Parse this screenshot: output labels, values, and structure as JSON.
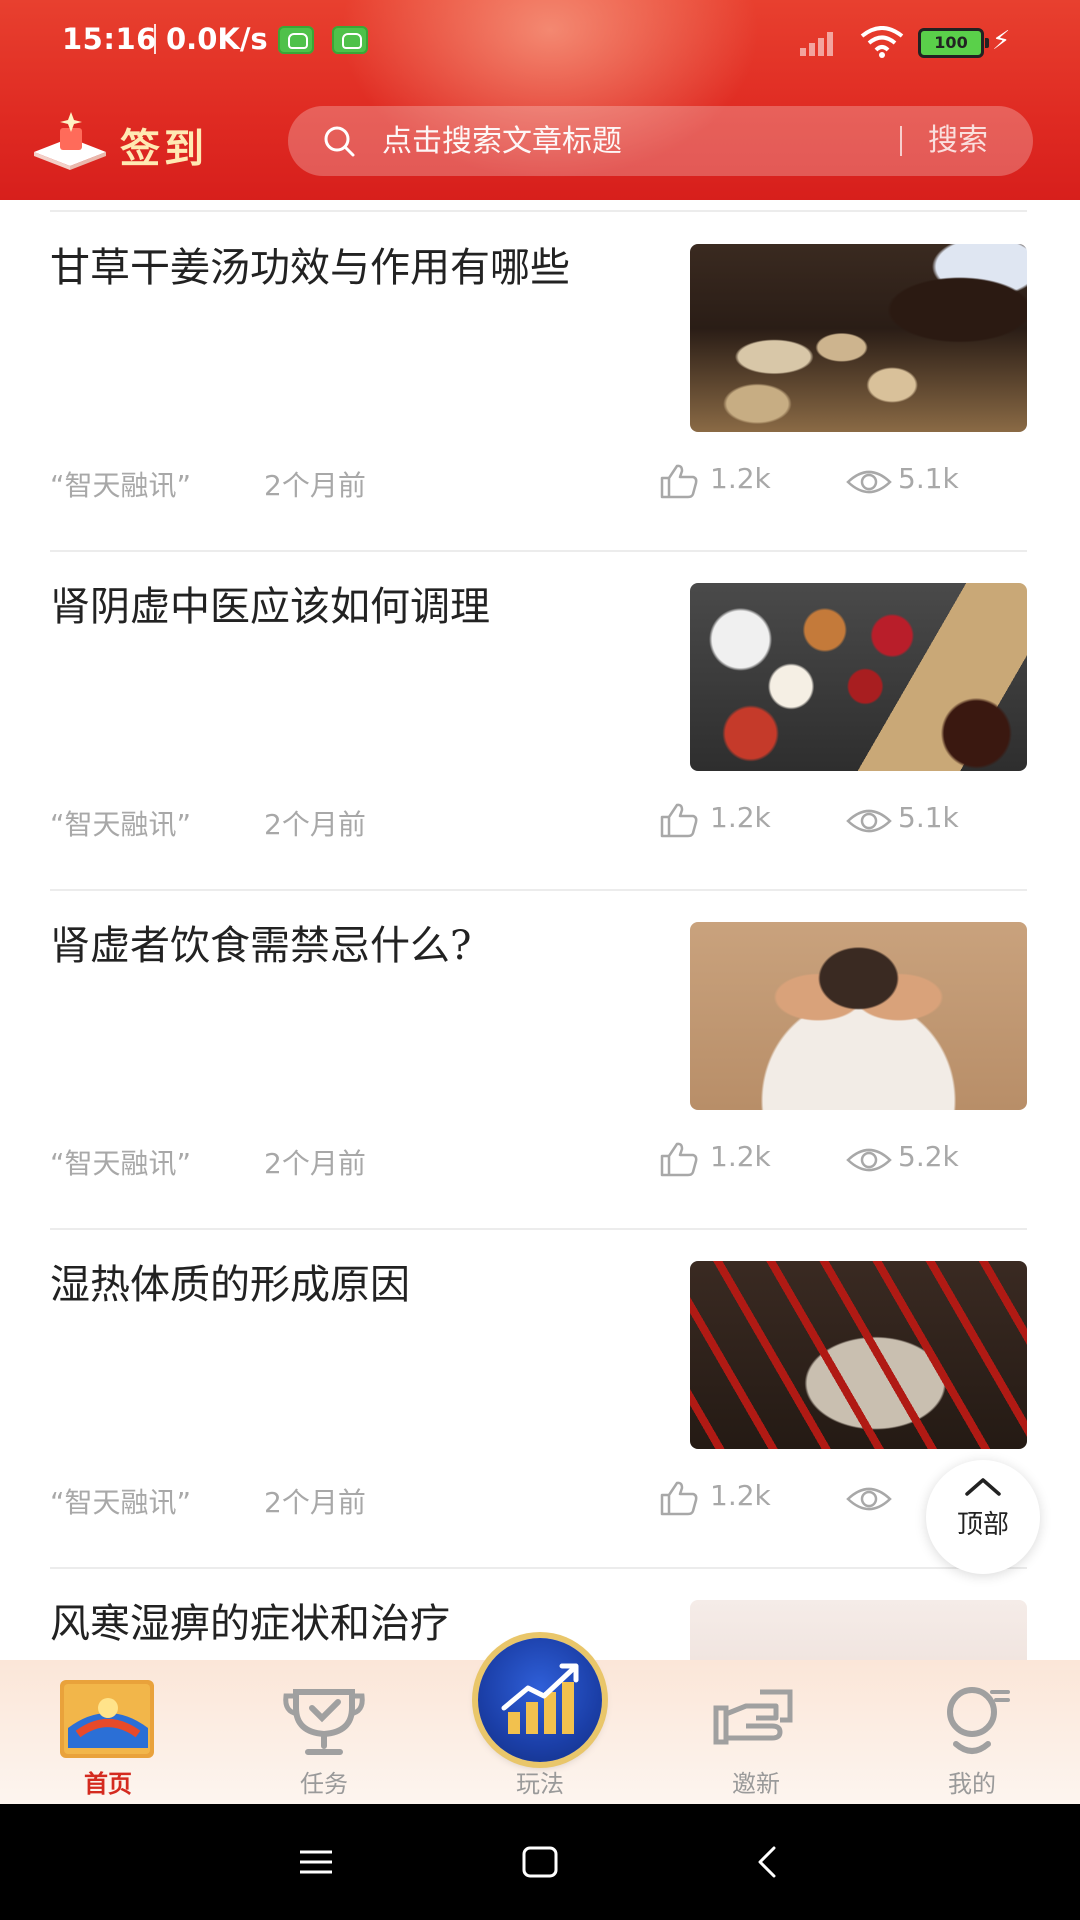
{
  "status_bar": {
    "time": "15:16",
    "net_speed": "0.0K/s",
    "battery": "100"
  },
  "header": {
    "signin_label": "签到",
    "search_placeholder": "点击搜索文章标题",
    "search_button": "搜索"
  },
  "articles": [
    {
      "title": "甘草干姜汤功效与作用有哪些",
      "source": "“智天融讯”",
      "time": "2个月前",
      "likes": "1.2k",
      "views": "5.1k"
    },
    {
      "title": "肾阴虚中医应该如何调理",
      "source": "“智天融讯”",
      "time": "2个月前",
      "likes": "1.2k",
      "views": "5.1k"
    },
    {
      "title": "肾虚者饮食需禁忌什么?",
      "source": "“智天融讯”",
      "time": "2个月前",
      "likes": "1.2k",
      "views": "5.2k"
    },
    {
      "title": "湿热体质的形成原因",
      "source": "“智天融讯”",
      "time": "2个月前",
      "likes": "1.2k",
      "views": ""
    },
    {
      "title": "风寒湿痹的症状和治疗"
    }
  ],
  "back_to_top": "顶部",
  "tabs": [
    {
      "label": "首页",
      "active": true
    },
    {
      "label": "任务"
    },
    {
      "label": "玩法"
    },
    {
      "label": "邀新"
    },
    {
      "label": "我的"
    }
  ],
  "colors": {
    "brand_red": "#df2a22",
    "active_tab": "#d42a1f",
    "meta_gray": "#a8a8a8"
  }
}
